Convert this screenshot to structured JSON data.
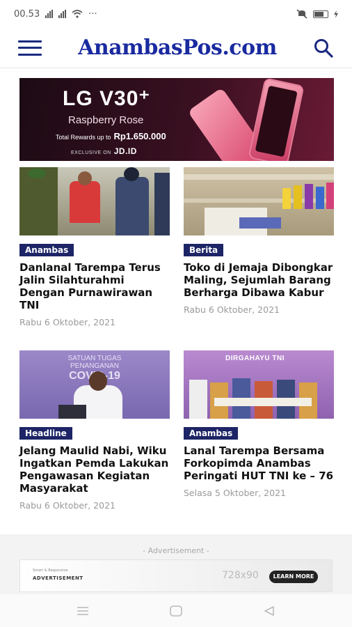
{
  "status": {
    "time": "00.53",
    "dots": "···"
  },
  "header": {
    "logo": "AnambasPos.com"
  },
  "banner": {
    "brand": "LG V30⁺",
    "subtitle": "Raspberry Rose",
    "rewards_label": "Total Rewards up to",
    "rewards_value": "Rp1.650.000",
    "exclusive_label": "EXCLUSIVE ON",
    "exclusive_store": "JD.ID"
  },
  "articles": [
    {
      "category": "Anambas",
      "title": "Danlanal Tarempa Terus Jalin Silahturahmi Dengan Purnawirawan TNI",
      "date": "Rabu 6 Oktober, 2021"
    },
    {
      "category": "Berita",
      "title": "Toko di Jemaja Dibongkar Maling, Sejumlah Barang Berharga Dibawa Kabur",
      "date": "Rabu 6 Oktober, 2021"
    },
    {
      "category": "Headline",
      "title": "Jelang Maulid Nabi, Wiku Ingatkan Pemda Lakukan Pengawasan Kegiatan Masyarakat",
      "date": "Rabu 6 Oktober, 2021"
    },
    {
      "category": "Anambas",
      "title": "Lanal Tarempa Bersama Forkopimda Anambas Peringati HUT TNI ke – 76",
      "date": "Selasa 5 Oktober, 2021"
    }
  ],
  "thumb_texts": {
    "covid_line1": "SATUAN TUGAS",
    "covid_line2": "PENANGANAN",
    "covid_line3": "COVID-19",
    "dirgahayu": "DIRGAHAYU TNI"
  },
  "ad": {
    "label": "- Advertisement -",
    "small": "Smart & Responsive",
    "title": "ADVERTISEMENT",
    "size": "728x90",
    "button": "LEARN MORE"
  }
}
